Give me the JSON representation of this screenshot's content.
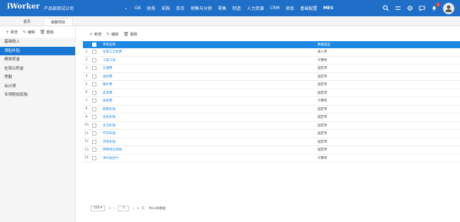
{
  "header": {
    "brand": "iWorker",
    "company": "产品部测试公司",
    "nav_chevron": "⌄",
    "nav": [
      "OA",
      "财务",
      "采购",
      "库存",
      "销售与分销",
      "零售",
      "制造",
      "人力资源",
      "CRM",
      "项目",
      "基础配置"
    ],
    "mes_label": "MES",
    "notif_count": "1"
  },
  "tabs": {
    "home": "首页",
    "active": "薪酬项目"
  },
  "left_toolbar": {
    "add": "新增",
    "edit": "编辑",
    "delete": "删除"
  },
  "left_items": [
    "基础收入",
    "津贴补贴",
    "绩效奖金",
    "社保公积金",
    "考勤",
    "合计项",
    "专项附加扣除"
  ],
  "right_toolbar": {
    "add": "新增",
    "edit": "编辑",
    "delete": "删除"
  },
  "table": {
    "headers": {
      "name": "项目名称",
      "type": "数据类型"
    },
    "rows": [
      {
        "num": "1",
        "name": "女职工卫生费",
        "type": "录入项"
      },
      {
        "num": "2",
        "name": "工龄工资",
        "type": "计算项"
      },
      {
        "num": "3",
        "name": "交通费",
        "type": "固定项"
      },
      {
        "num": "4",
        "name": "通讯费",
        "type": "固定项"
      },
      {
        "num": "5",
        "name": "餐补费",
        "type": "固定项"
      },
      {
        "num": "6",
        "name": "高温费",
        "type": "固定项"
      },
      {
        "num": "7",
        "name": "加班费",
        "type": "计算项"
      },
      {
        "num": "8",
        "name": "取暖补贴",
        "type": "固定项"
      },
      {
        "num": "9",
        "name": "住房补贴",
        "type": "固定项"
      },
      {
        "num": "10",
        "name": "生活补贴",
        "type": "固定项"
      },
      {
        "num": "11",
        "name": "节日补贴",
        "type": "固定项"
      },
      {
        "num": "12",
        "name": "其他补贴",
        "type": "固定项"
      },
      {
        "num": "13",
        "name": "特殊岗位津贴",
        "type": "固定项"
      },
      {
        "num": "14",
        "name": "津补贴合计",
        "type": "计算项"
      }
    ]
  },
  "pager": {
    "page_size": "100 ▾",
    "first": "«",
    "prev": "‹",
    "page": "1",
    "next": "›",
    "last": "»",
    "refresh": "C",
    "total": "共14条数据"
  },
  "colors": {
    "primary": "#1f6ec8",
    "selected": "#1976d2",
    "grid_header": "#1e88e5"
  },
  "icons": [
    "search-icon",
    "menu-icon",
    "settings-icon",
    "chat-icon",
    "bell-icon",
    "plus-icon",
    "edit-icon",
    "trash-icon"
  ]
}
